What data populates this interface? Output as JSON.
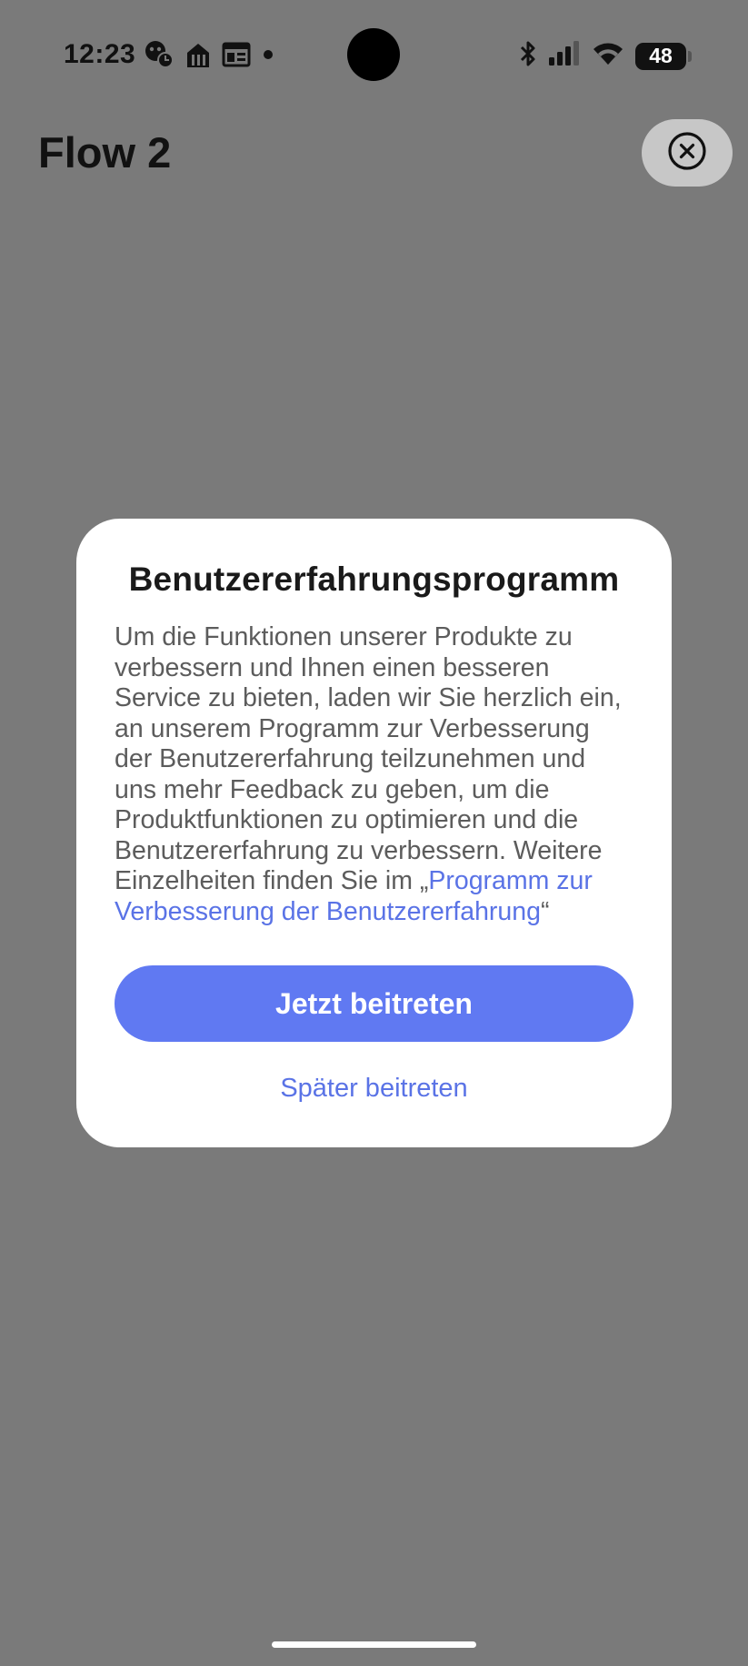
{
  "status_bar": {
    "time": "12:23",
    "battery_level": "48",
    "icons": [
      "game-notification-icon",
      "food-delivery-icon",
      "news-icon",
      "more-dot-icon",
      "bluetooth-icon",
      "signal-icon",
      "wifi-icon",
      "battery-icon"
    ]
  },
  "header": {
    "title": "Flow 2",
    "close_icon": "close-circle-icon"
  },
  "dialog": {
    "title": "Benutzererfahrungsprogramm",
    "body_text": "Um die Funktionen unserer Produkte zu verbessern und Ihnen einen besseren Service zu bieten, laden wir Sie herzlich ein, an unserem Programm zur Verbesserung der Benutzererfahrung teilzunehmen und uns mehr Feedback zu geben, um die Produktfunktionen zu optimieren und die Benutzererfahrung zu verbessern. Weitere Einzelheiten finden Sie im „",
    "link_text": "Programm zur Verbesserung der Benutzererfahrung",
    "body_suffix": "“",
    "primary_button": "Jetzt beitreten",
    "secondary_button": "Später beitreten"
  },
  "colors": {
    "backdrop": "#7a7a7a",
    "accent": "#6079f2",
    "link": "#5a73e6",
    "dialog_bg": "#ffffff"
  }
}
